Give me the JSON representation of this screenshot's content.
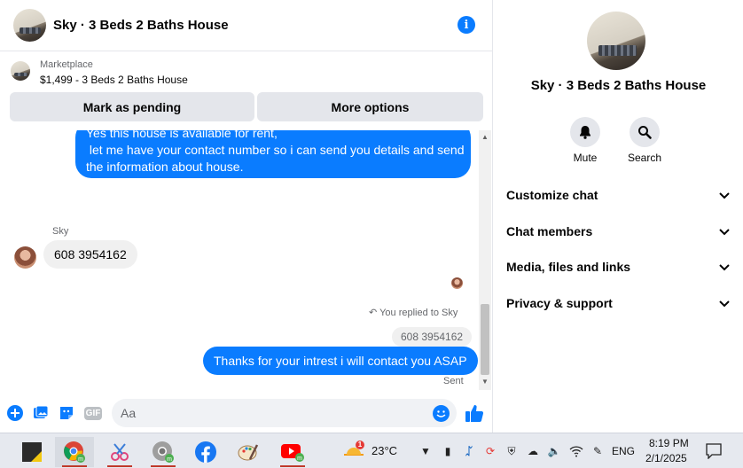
{
  "header": {
    "title": "Sky · 3 Beds 2 Baths House",
    "info_icon": "info-icon"
  },
  "marketplace": {
    "label": "Marketplace",
    "listing": "$1,499 - 3 Beds 2 Baths House",
    "mark_pending_label": "Mark as pending",
    "more_options_label": "More options"
  },
  "thread": {
    "msg1_line1": "Yes this house is  available for rent,",
    "msg1_line2": " let me have your contact number so i can send you details and send",
    "msg1_line3": "the information about house.",
    "sender_name": "Sky",
    "msg2": "608 3954162",
    "replied_label": "You replied to Sky",
    "quoted": "608 3954162",
    "msg3": "Thanks for your intrest i will contact you ASAP",
    "status": "Sent"
  },
  "composer": {
    "placeholder": "Aa",
    "gif_label": "GIF"
  },
  "details": {
    "name": "Sky · 3 Beds 2 Baths House",
    "mute_label": "Mute",
    "search_label": "Search",
    "sections": [
      "Customize chat",
      "Chat members",
      "Media, files and links",
      "Privacy & support"
    ]
  },
  "taskbar": {
    "temperature": "23°C",
    "weather_badge": "1",
    "language": "ENG",
    "time": "8:19 PM",
    "date": "2/1/2025"
  },
  "colors": {
    "accent": "#0a7cff",
    "bubble_in": "#f0f0f0",
    "button_bg": "#e4e6eb"
  }
}
